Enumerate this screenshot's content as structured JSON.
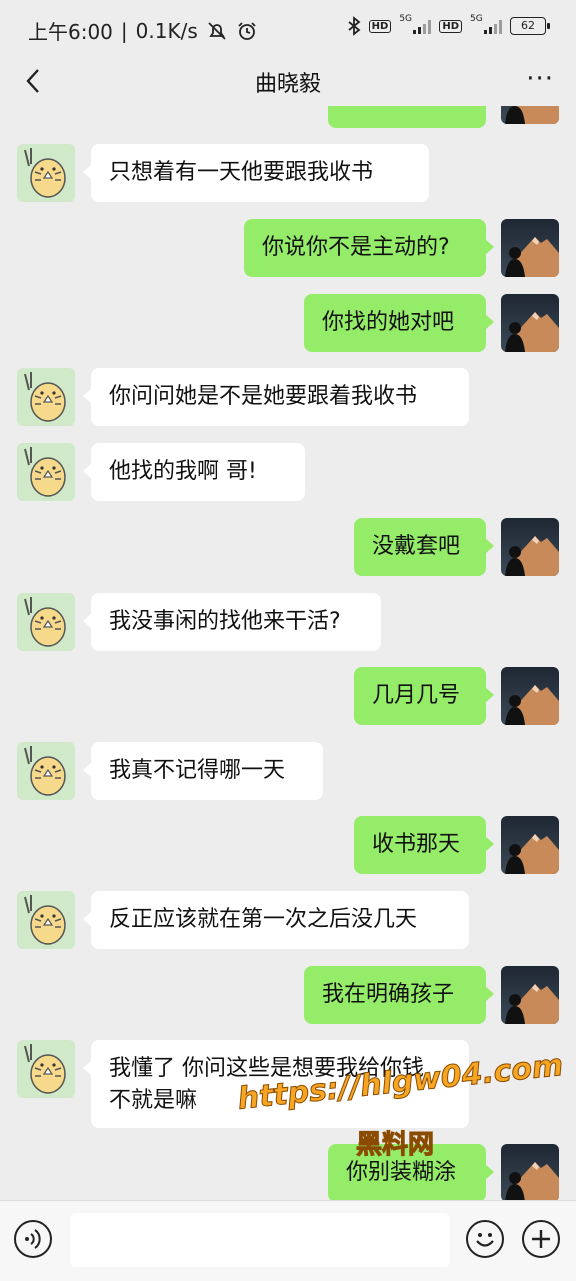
{
  "status_bar": {
    "time": "上午6:00",
    "speed": "0.1K/s",
    "hd1": "HD",
    "net1": "5G",
    "hd2": "HD",
    "net2": "5G",
    "battery": "62"
  },
  "header": {
    "title": "曲晓毅",
    "more": "···"
  },
  "messages": [
    {
      "side": "out",
      "text": ""
    },
    {
      "side": "in",
      "text": "只想着有一天他要跟我收书"
    },
    {
      "side": "out",
      "text": "你说你不是主动的?"
    },
    {
      "side": "out",
      "text": "你找的她对吧"
    },
    {
      "side": "in",
      "text": "你问问她是不是她要跟着我收书"
    },
    {
      "side": "in",
      "text": "他找的我啊 哥!"
    },
    {
      "side": "out",
      "text": "没戴套吧"
    },
    {
      "side": "in",
      "text": "我没事闲的找他来干活?"
    },
    {
      "side": "out",
      "text": "几月几号"
    },
    {
      "side": "in",
      "text": "我真不记得哪一天"
    },
    {
      "side": "out",
      "text": "收书那天"
    },
    {
      "side": "in",
      "text": "反正应该就在第一次之后没几天"
    },
    {
      "side": "out",
      "text": "我在明确孩子"
    },
    {
      "side": "in",
      "text": "我懂了 你问这些是想要我给你钱\n不就是嘛"
    },
    {
      "side": "out",
      "text": "你别装糊涂"
    }
  ],
  "watermark": {
    "url": "https://hlgw04.com",
    "name": "黑料网"
  },
  "input_bar": {
    "placeholder": ""
  },
  "colors": {
    "background": "#ededed",
    "outgoing_bubble": "#95ec69",
    "incoming_bubble": "#ffffff"
  }
}
